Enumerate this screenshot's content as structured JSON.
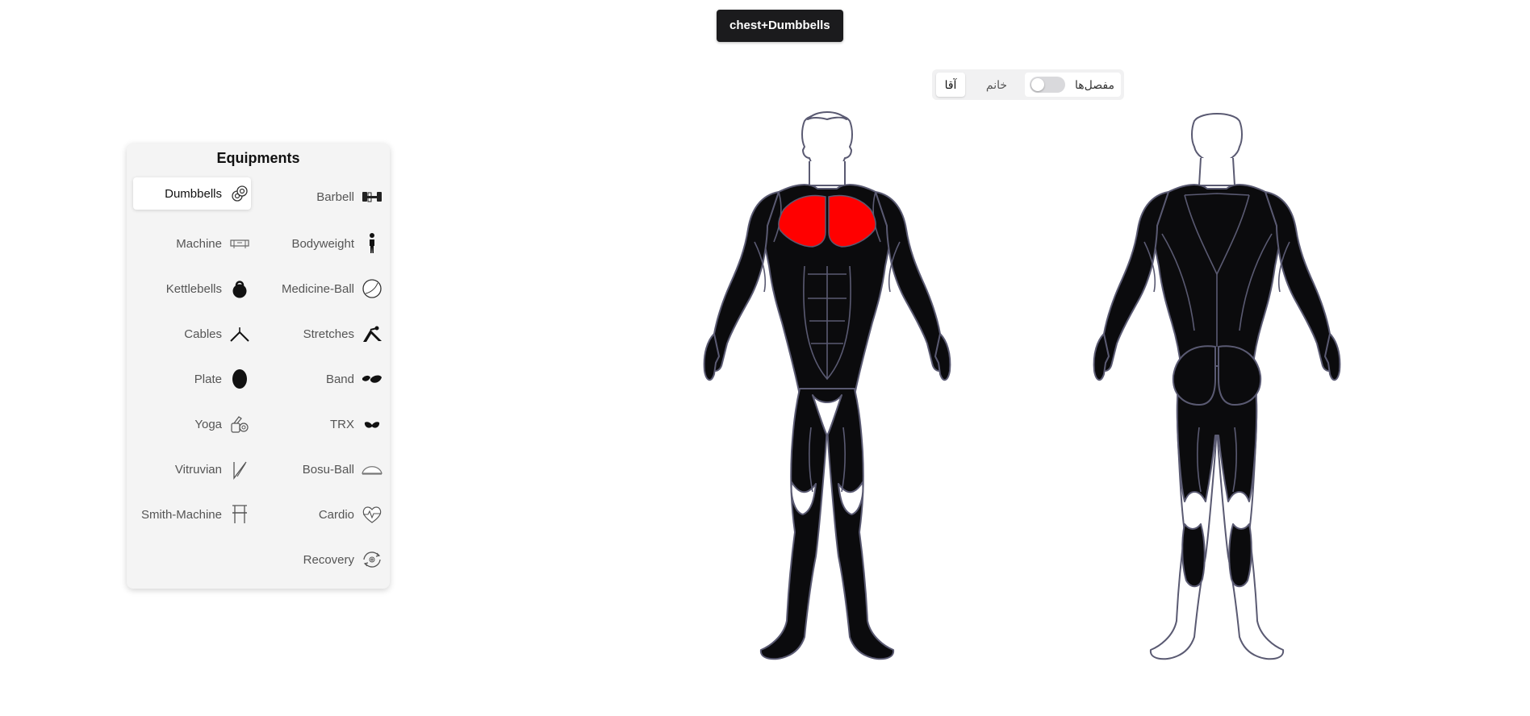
{
  "selection_chip": "chest+Dumbbells",
  "controls": {
    "male_label": "آقا",
    "female_label": "خانم",
    "joints_label": "مفصل‌ها",
    "joints_toggle_on": false
  },
  "equipment_panel": {
    "title": "Equipments",
    "items": [
      {
        "label": "Dumbbells",
        "icon": "dumbbells-icon",
        "active": true
      },
      {
        "label": "Barbell",
        "icon": "barbell-icon"
      },
      {
        "label": "Machine",
        "icon": "machine-icon"
      },
      {
        "label": "Bodyweight",
        "icon": "bodyweight-icon"
      },
      {
        "label": "Kettlebells",
        "icon": "kettlebell-icon"
      },
      {
        "label": "Medicine-Ball",
        "icon": "medicine-ball-icon"
      },
      {
        "label": "Cables",
        "icon": "cables-icon"
      },
      {
        "label": "Stretches",
        "icon": "stretches-icon"
      },
      {
        "label": "Plate",
        "icon": "plate-icon"
      },
      {
        "label": "Band",
        "icon": "band-icon"
      },
      {
        "label": "Yoga",
        "icon": "yoga-icon"
      },
      {
        "label": "TRX",
        "icon": "trx-icon"
      },
      {
        "label": "Vitruvian",
        "icon": "vitruvian-icon"
      },
      {
        "label": "Bosu-Ball",
        "icon": "bosu-ball-icon"
      },
      {
        "label": "Smith-Machine",
        "icon": "smith-machine-icon"
      },
      {
        "label": "Cardio",
        "icon": "cardio-icon"
      },
      {
        "label": "Recovery",
        "icon": "recovery-icon"
      }
    ]
  },
  "body_map": {
    "highlighted_muscle": "chest",
    "highlight_color": "#ff0000",
    "muscle_color": "#0b0b0d",
    "outline_color": "#5a5a72"
  }
}
